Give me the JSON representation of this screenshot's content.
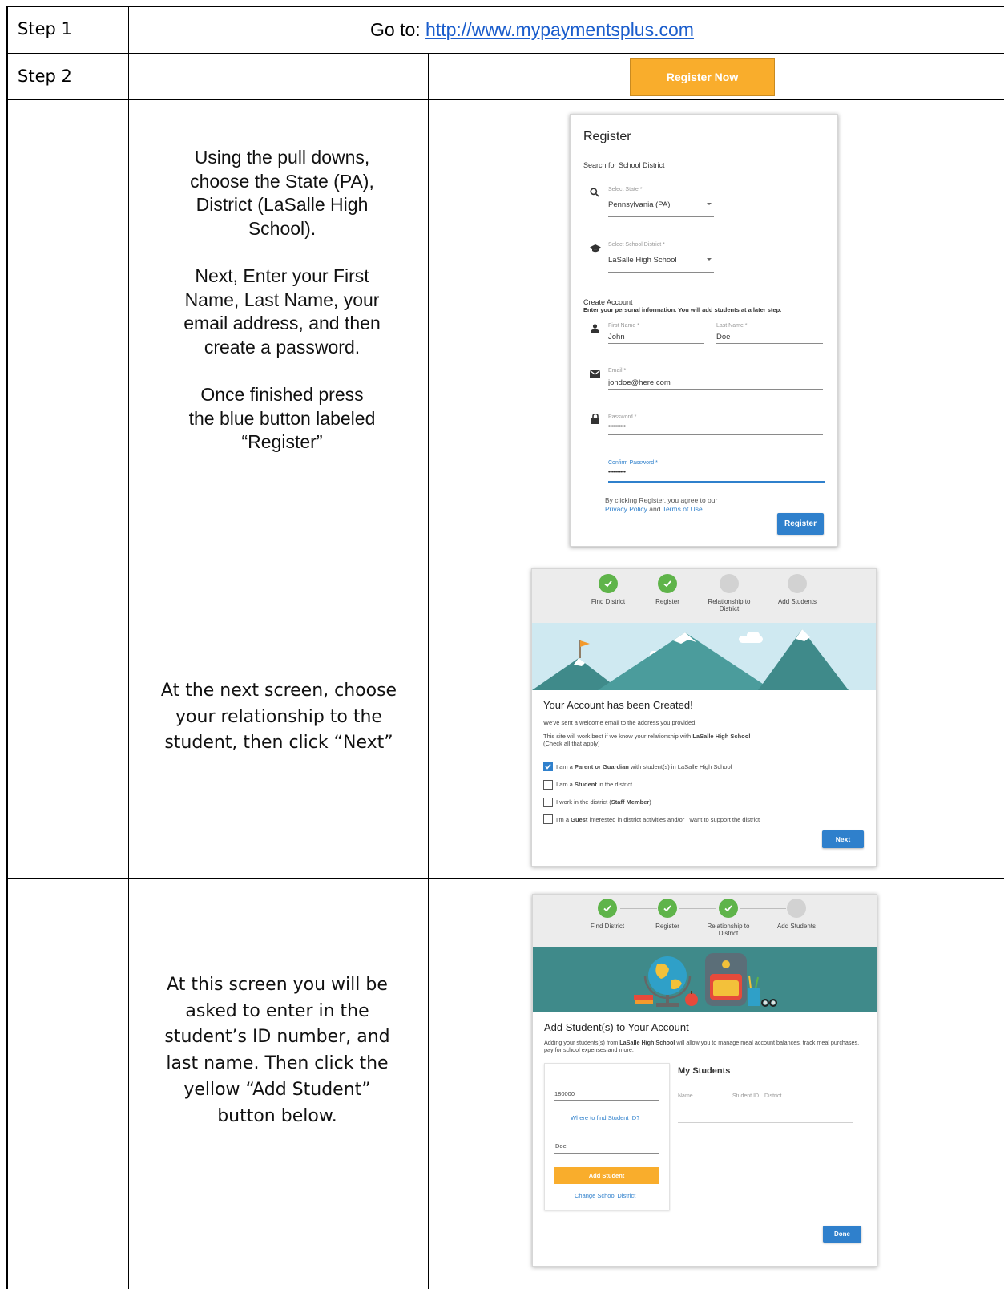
{
  "rows": {
    "step1": {
      "label": "Step 1",
      "prefix": "Go to: ",
      "url": "http://www.mypaymentsplus.com"
    },
    "step2": {
      "label": "Step 2",
      "button": "Register Now"
    },
    "row3": {
      "p1": "Using the pull downs, choose the State (PA), District (LaSalle High School).",
      "p2": "Next, Enter your First Name, Last Name, your email address, and then create a password.",
      "p3": "Once finished press the blue button labeled “Register”"
    },
    "row4": {
      "text": "At the next screen, choose your relationship to the student, then click “Next”"
    },
    "row5": {
      "text": "At this screen you will be asked to enter in the student’s ID number, and last name. Then click the yellow “Add Student” button below."
    }
  },
  "register_form": {
    "title": "Register",
    "search_heading": "Search for School District",
    "state_label": "Select State *",
    "state_value": "Pennsylvania (PA)",
    "district_label": "Select School District *",
    "district_value": "LaSalle High School",
    "create_heading": "Create Account",
    "create_sub": "Enter your personal information.  You will add students at a later step.",
    "first_label": "First Name *",
    "first_value": "John",
    "last_label": "Last Name *",
    "last_value": "Doe",
    "email_label": "Email *",
    "email_value": "jondoe@here.com",
    "password_label": "Password *",
    "password_value": "•••••••••••",
    "confirm_label": "Confirm Password *",
    "confirm_value": "•••••••••••",
    "agree_text": "By clicking Register, you agree to our",
    "privacy": "Privacy Policy",
    "and": "and",
    "terms": "Terms of Use.",
    "register_btn": "Register"
  },
  "stepper": {
    "steps": [
      "Find District",
      "Register",
      "Relationship to District",
      "Add Students"
    ],
    "panel_a_done": 2,
    "panel_b_done": 3
  },
  "relationship": {
    "title": "Your Account has been Created!",
    "line1": "We've sent a welcome email to the address you provided.",
    "line2_pre": "This site will work best if we know your relationship with ",
    "line2_school": "LaSalle High School",
    "line3": "(Check all that apply)",
    "options": [
      {
        "pre": "I am a ",
        "bold": "Parent or Guardian",
        "post": " with student(s) in LaSalle High School",
        "checked": true
      },
      {
        "pre": "I am a ",
        "bold": "Student",
        "post": " in the district",
        "checked": false
      },
      {
        "pre": "I work in the district (",
        "bold": "Staff Member",
        "post": ")",
        "checked": false
      },
      {
        "pre": "I'm a ",
        "bold": "Guest",
        "post": " interested in district activities and/or I want to support the district",
        "checked": false
      }
    ],
    "next_btn": "Next"
  },
  "add_students": {
    "title": "Add Student(s) to Your Account",
    "desc_pre": "Adding your students(s) from ",
    "desc_school": "LaSalle High School",
    "desc_post": " will allow you to manage meal account balances, track meal purchases, pay for school expenses and more.",
    "id_value": "180000",
    "where_link": "Where to find Student ID?",
    "last_value": "Doe",
    "add_btn": "Add Student",
    "change_link": "Change School District",
    "my_students": "My Students",
    "col_name": "Name",
    "col_id": "Student ID",
    "col_district": "District",
    "done_btn": "Done"
  },
  "colors": {
    "blue": "#2f80cc",
    "orange": "#f9ad2c",
    "green": "#5fb44a",
    "sky": "#cfe9f1",
    "teal": "#3f8a8a"
  }
}
